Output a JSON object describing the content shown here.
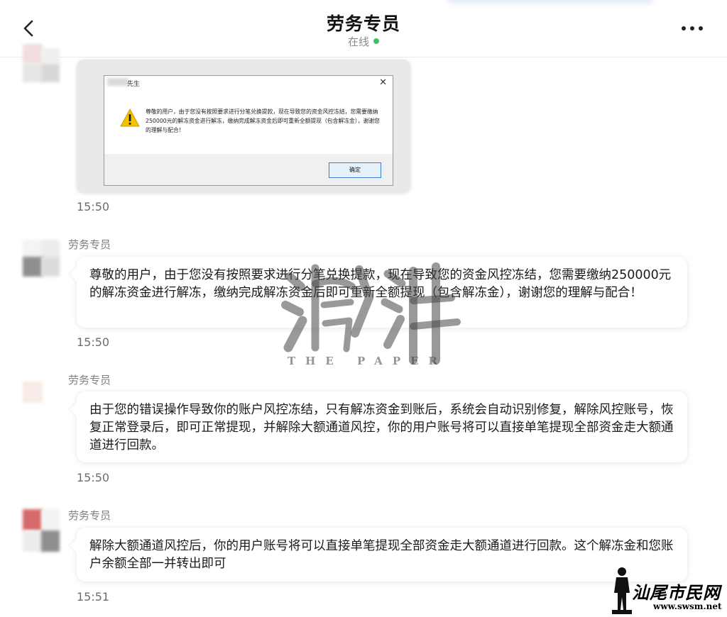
{
  "header": {
    "title": "劳务专员",
    "status": "在线"
  },
  "image_message": {
    "dialog_caption": "先生",
    "dialog_close": "✕",
    "dialog_text": "尊敬的用户，由于您没有按照要求进行分笔兑换提款，现在导致您的资金风控冻结，您需要缴纳250000元的解冻资金进行解冻，缴纳完成解冻资金后即可重新全额提现（包含解冻金），谢谢您的理解与配合！",
    "dialog_ok": "确定",
    "time": "15:50"
  },
  "messages": [
    {
      "sender": "劳务专员",
      "text": "尊敬的用户，由于您没有按照要求进行分笔兑换提款，现在导致您的资金风控冻结，您需要缴纳250000元的解冻资金进行解冻，缴纳完成解冻资金后即可重新全额提现（包含解冻金），谢谢您的理解与配合！",
      "time": "15:50"
    },
    {
      "sender": "劳务专员",
      "text": "由于您的错误操作导致你的账户风控冻结，只有解冻资金到账后，系统会自动识别修复，解除风控账号，恢复正常登录后，即可正常提现，并解除大额通道风控，你的用户账号将可以直接单笔提现全部资金走大额通道进行回款。",
      "time": "15:50"
    },
    {
      "sender": "劳务专员",
      "text": "解除大额通道风控后，你的用户账号将可以直接单笔提现全部资金走大额通道进行回款。这个解冻金和您账户余额全部一并转出即可",
      "time": "15:51"
    }
  ],
  "watermark": {
    "sub_text": "THE PAPER"
  },
  "corner_logo": {
    "name": "汕尾市民网",
    "url": "www.swsm.net"
  },
  "colors": {
    "online_dot": "#3fc25c",
    "avatar_red": "#d46a6a"
  }
}
